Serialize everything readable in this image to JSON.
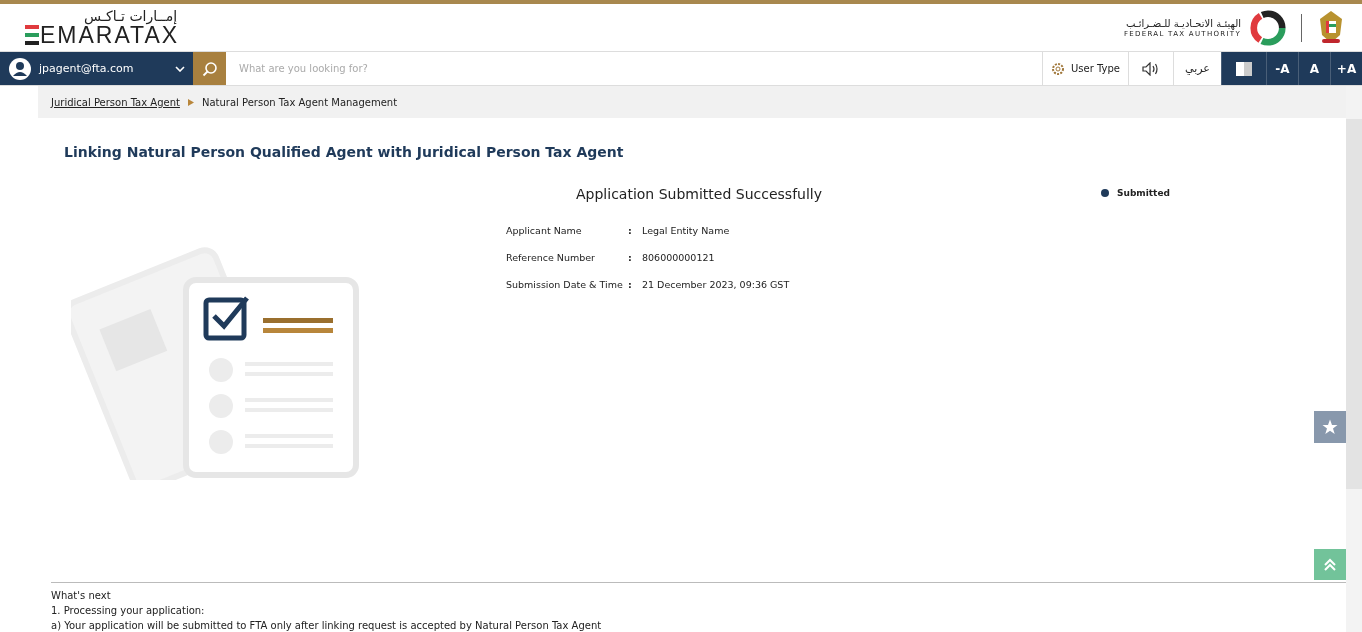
{
  "header": {
    "logo_arabic": "إمــارات تـاكـس",
    "logo_text": "EMARATAX",
    "authority_arabic": "الهيئـة الاتحـاديـة للـضـرائـب",
    "authority_english": "FEDERAL TAX AUTHORITY"
  },
  "toolbar": {
    "user": "jpagent@fta.com",
    "search": {
      "placeholder": "What are you looking for?"
    },
    "user_type": "User Type",
    "language": "عربي",
    "font_sizes": [
      "-A",
      "A",
      "+A"
    ]
  },
  "breadcrumb": [
    {
      "label": "Juridical Person Tax Agent",
      "kind": "link"
    },
    {
      "label": "Natural Person Tax Agent Management",
      "kind": "current"
    }
  ],
  "page_title": "Linking Natural Person Qualified Agent with Juridical Person Tax Agent",
  "result": {
    "heading": "Application Submitted Successfully",
    "status": {
      "label": "Submitted",
      "color": "#1f3a5a"
    },
    "fields": [
      {
        "label": "Applicant Name",
        "separator": ":",
        "value": "Legal Entity Name"
      },
      {
        "label": "Reference Number",
        "separator": ":",
        "value": "806000000121"
      },
      {
        "label": "Submission Date & Time",
        "separator": ":",
        "value": "21 December 2023, 09:36 GST"
      }
    ]
  },
  "whats_next": {
    "title": "What's next",
    "lines": [
      "1. Processing your application:",
      "a) Your application will be submitted to FTA only after linking request is accepted by Natural Person Tax Agent"
    ]
  }
}
